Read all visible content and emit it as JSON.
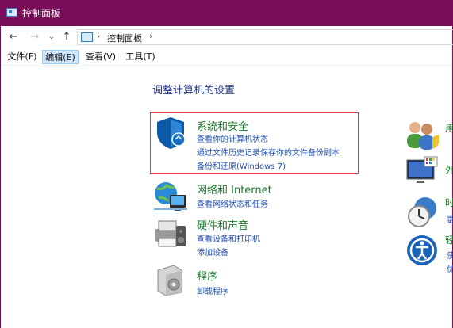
{
  "window": {
    "title": "控制面板"
  },
  "nav": {
    "back": "←",
    "forward": "→",
    "history": "⌄",
    "up": "↑",
    "path_sep1": "›",
    "address": "控制面板",
    "path_sep2": "›"
  },
  "menu": {
    "file": "文件(F)",
    "edit": "编辑(E)",
    "view": "查看(V)",
    "tools": "工具(T)"
  },
  "page": {
    "title": "调整计算机的设置"
  },
  "categories": [
    {
      "title": "系统和安全",
      "links": [
        "查看你的计算机状态",
        "通过文件历史记录保存你的文件备份副本",
        "备份和还原(Windows 7)"
      ]
    },
    {
      "title": "网络和 Internet",
      "links": [
        "查看网络状态和任务"
      ]
    },
    {
      "title": "硬件和声音",
      "links": [
        "查看设备和打印机",
        "添加设备"
      ]
    },
    {
      "title": "程序",
      "links": [
        "卸载程序"
      ]
    }
  ],
  "right": {
    "users_title": "用",
    "appearance_title": "外",
    "clock_title": "时",
    "clock_link": "更",
    "access_title": "轻",
    "access_link1": "使",
    "access_link2": "优"
  },
  "colors": {
    "title_bar": "#7a0d5a",
    "category_green": "#1a7a28",
    "link_blue": "#1f4fb5",
    "highlight_red": "#e63c3c"
  }
}
